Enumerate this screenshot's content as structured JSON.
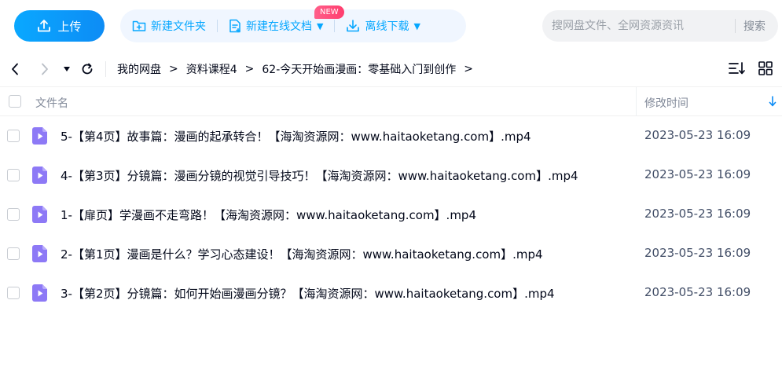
{
  "toolbar": {
    "upload_label": "上传",
    "new_folder_label": "新建文件夹",
    "new_online_doc_label": "新建在线文档",
    "new_badge": "NEW",
    "offline_download_label": "离线下载",
    "search_placeholder": "搜网盘文件、全网资源资讯",
    "search_button": "搜索"
  },
  "breadcrumb": {
    "items": [
      "我的网盘",
      "资料课程4",
      "62-今天开始画漫画：零基础入门到创作"
    ],
    "separator": ">"
  },
  "table": {
    "columns": {
      "name": "文件名",
      "modified": "修改时间"
    },
    "rows": [
      {
        "name": "5-【第4页】故事篇：漫画的起承转合！【海淘资源网：www.haitaoketang.com】.mp4",
        "modified": "2023-05-23 16:09"
      },
      {
        "name": "4-【第3页】分镜篇：漫画分镜的视觉引导技巧！【海淘资源网：www.haitaoketang.com】.mp4",
        "modified": "2023-05-23 16:09"
      },
      {
        "name": "1-【扉页】学漫画不走弯路！【海淘资源网：www.haitaoketang.com】.mp4",
        "modified": "2023-05-23 16:09"
      },
      {
        "name": "2-【第1页】漫画是什么？学习心态建设！【海淘资源网：www.haitaoketang.com】.mp4",
        "modified": "2023-05-23 16:09"
      },
      {
        "name": "3-【第2页】分镜篇：如何开始画漫画分镜？【海淘资源网：www.haitaoketang.com】.mp4",
        "modified": "2023-05-23 16:09"
      }
    ]
  },
  "colors": {
    "accent": "#06a7ff",
    "video_icon": "#8d79f6"
  },
  "icons": {
    "upload": "upload-icon",
    "new_folder": "folder-plus-icon",
    "new_doc": "doc-plus-icon",
    "offline": "download-icon",
    "back": "arrow-left-icon",
    "forward": "arrow-right-icon",
    "history": "caret-down-icon",
    "refresh": "refresh-icon",
    "sort": "sort-list-icon",
    "grid": "grid-view-icon",
    "file": "video-file-icon"
  }
}
